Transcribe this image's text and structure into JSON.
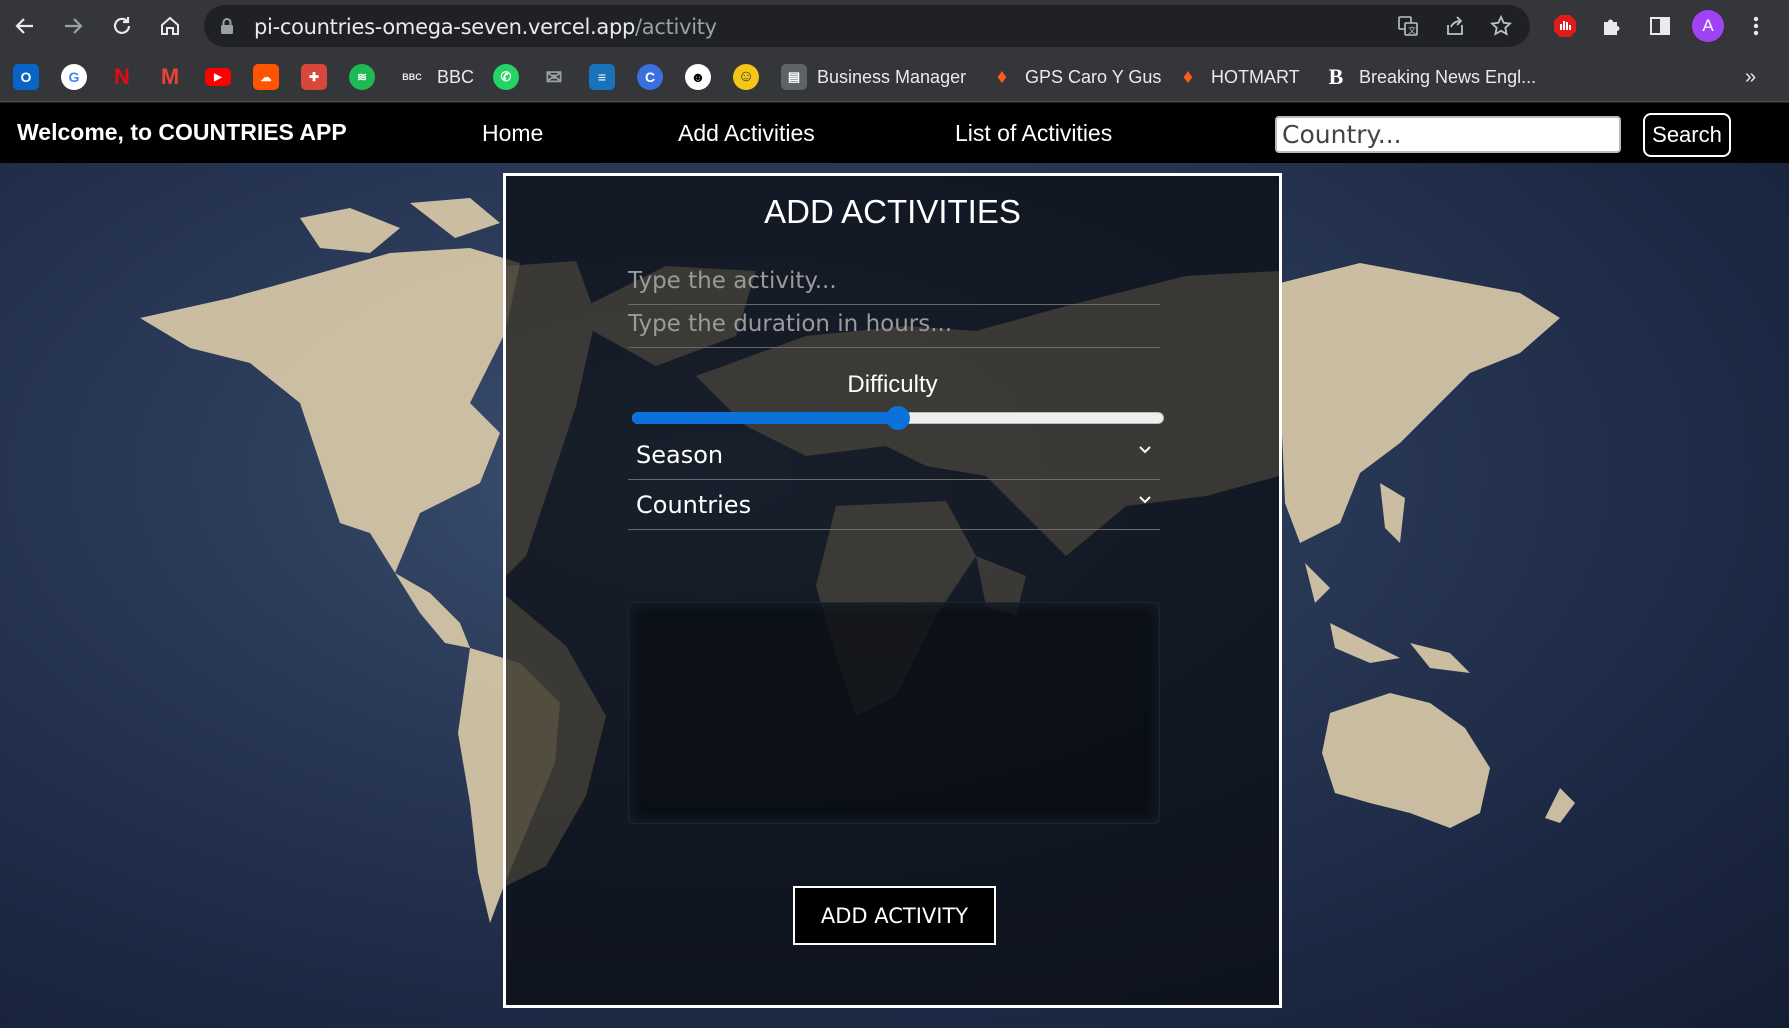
{
  "browser": {
    "url_host": "pi-countries-omega-seven.vercel.app",
    "url_path": "/activity",
    "profile_initial": "A",
    "bookmarks": [
      {
        "icon": "outlook-icon",
        "label": ""
      },
      {
        "icon": "google-icon",
        "label": ""
      },
      {
        "icon": "netflix-icon",
        "label": ""
      },
      {
        "icon": "gmail-icon",
        "label": ""
      },
      {
        "icon": "youtube-icon",
        "label": ""
      },
      {
        "icon": "soundcloud-icon",
        "label": ""
      },
      {
        "icon": "crest-icon",
        "label": ""
      },
      {
        "icon": "spotify-icon",
        "label": ""
      },
      {
        "icon": "bbc-icon",
        "label": "BBC"
      },
      {
        "icon": "whatsapp-icon",
        "label": ""
      },
      {
        "icon": "mail-icon",
        "label": ""
      },
      {
        "icon": "layers-icon",
        "label": ""
      },
      {
        "icon": "canva-icon",
        "label": ""
      },
      {
        "icon": "panda-icon",
        "label": ""
      },
      {
        "icon": "emoji-icon",
        "label": ""
      },
      {
        "icon": "page-icon",
        "label": "Business Manager"
      },
      {
        "icon": "fire-icon",
        "label": "GPS Caro Y Gus"
      },
      {
        "icon": "fire-icon",
        "label": "HOTMART"
      },
      {
        "icon": "b-icon",
        "label": "Breaking News Engl..."
      }
    ],
    "overflow": "»"
  },
  "app": {
    "brand": "Welcome, to COUNTRIES APP",
    "nav": {
      "home": "Home",
      "add": "Add Activities",
      "list": "List of Activities"
    },
    "search": {
      "placeholder": "Country...",
      "button": "Search"
    },
    "form": {
      "title": "ADD ACTIVITIES",
      "activity_placeholder": "Type the activity...",
      "duration_placeholder": "Type the duration in hours...",
      "difficulty_label": "Difficulty",
      "difficulty_value_fraction": 0.5,
      "season_label": "Season",
      "countries_label": "Countries",
      "submit": "ADD ACTIVITY"
    }
  },
  "colors": {
    "accent": "#0a72d8",
    "navbar": "#000000",
    "land": "#d9c9a8",
    "ocean": "#2a3a58"
  }
}
